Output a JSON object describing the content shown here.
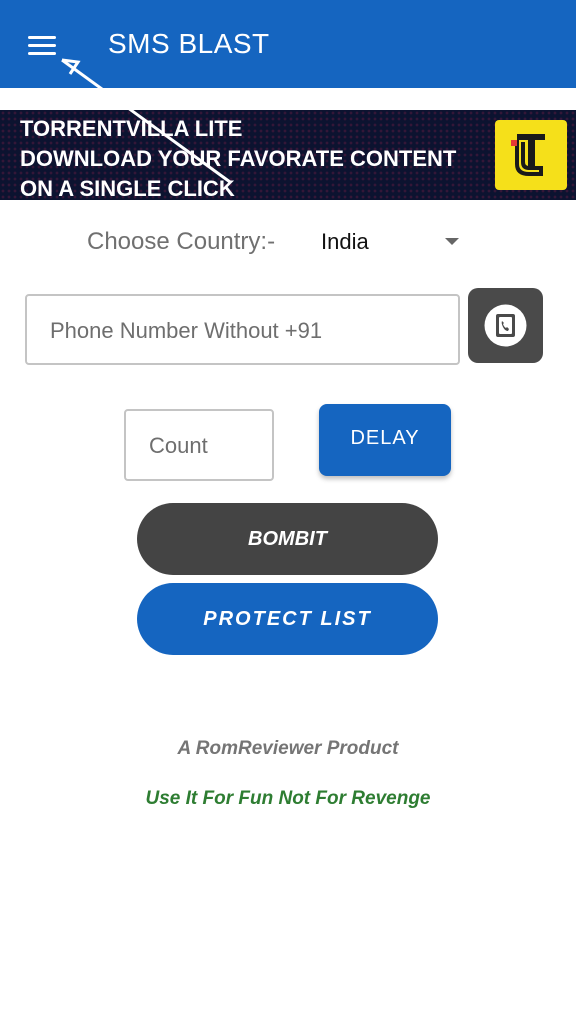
{
  "colors": {
    "primary": "#1565c0",
    "dark_button": "#444444",
    "tagline": "#2e7d32",
    "banner_logo": "#f5e01a"
  },
  "appbar": {
    "menu_icon": "hamburger-menu-icon",
    "title": "SMS BLAST"
  },
  "ad_banner": {
    "lines": [
      "TORRENTVILLA LITE",
      "DOWNLOAD YOUR FAVORATE CONTENT",
      "ON A SINGLE CLICK"
    ],
    "logo_icon": "torrentvilla-logo-icon"
  },
  "form": {
    "country_label": "Choose Country:-",
    "country_value": "India",
    "phone_placeholder": "Phone Number Without +91",
    "contact_icon": "contact-book-icon",
    "count_placeholder": "Count",
    "delay_label": "DELAY",
    "bombit_label": "BOMBIT",
    "protect_label": "PROTECT LIST"
  },
  "footer": {
    "credit": "A RomReviewer Product",
    "tagline": "Use It For Fun Not For Revenge"
  }
}
